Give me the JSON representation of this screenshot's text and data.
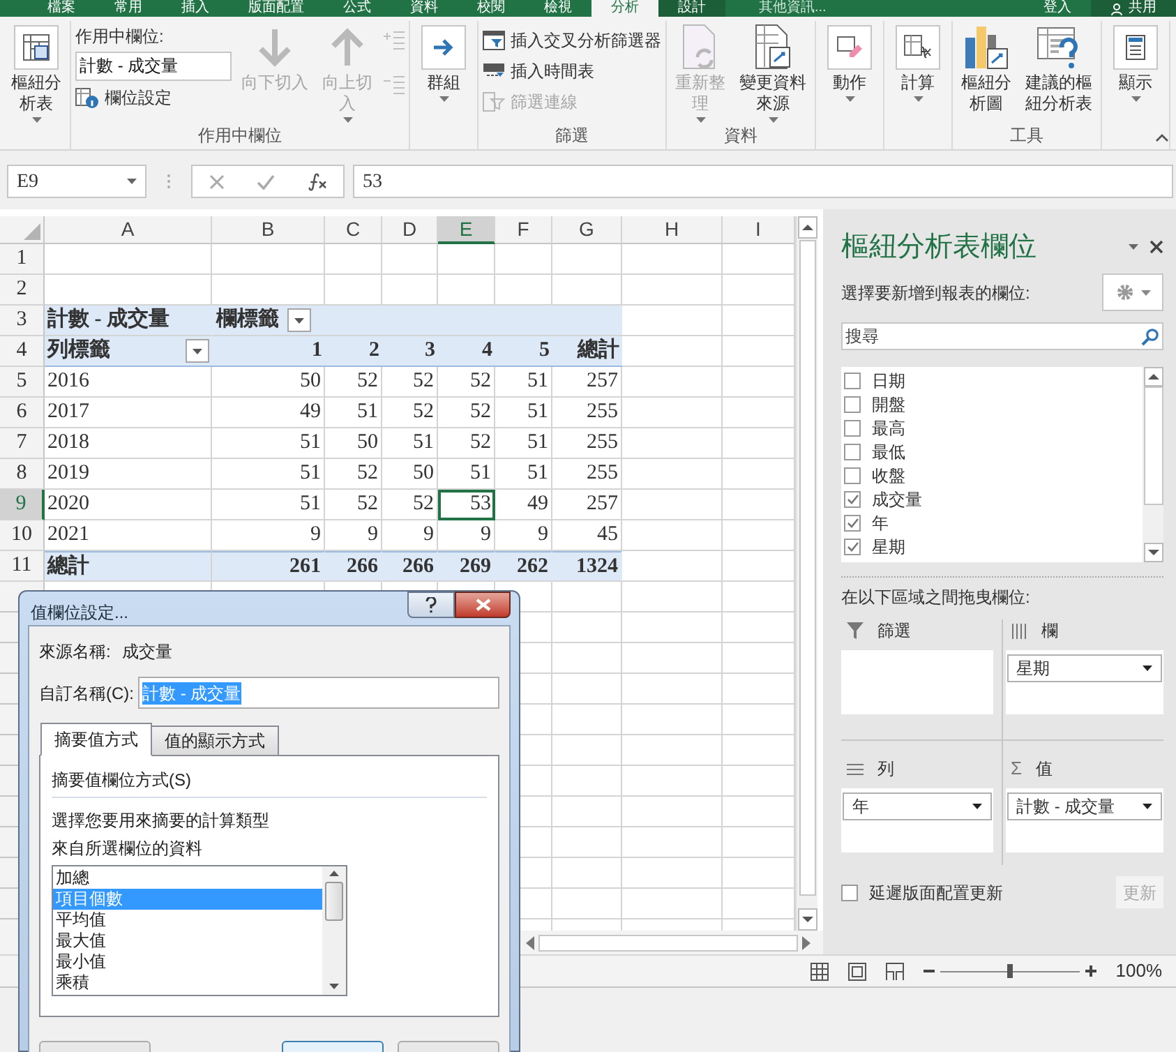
{
  "menu_tabs": [
    {
      "label": "檔案",
      "selected": false
    },
    {
      "label": "常用",
      "selected": false
    },
    {
      "label": "插入",
      "selected": false
    },
    {
      "label": "版面配置",
      "selected": false
    },
    {
      "label": "公式",
      "selected": false
    },
    {
      "label": "資料",
      "selected": false
    },
    {
      "label": "校閱",
      "selected": false
    },
    {
      "label": "檢視",
      "selected": false
    },
    {
      "label": "分析",
      "selected": true
    },
    {
      "label": "設計",
      "selected": false
    }
  ],
  "tell_me": "其他資訊...",
  "sign_in": "登入",
  "share": "共用",
  "ribbon": [
    {
      "kind": "buttons",
      "buttons": [
        {
          "label": "樞紐分析表",
          "dropdown": true,
          "disabled": false
        }
      ]
    },
    {
      "kind": "active-field",
      "label": "作用中欄位",
      "caption": "作用中欄位:",
      "value": "計數 - 成交量",
      "settings": "欄位設定",
      "buttons": [
        {
          "label": "向下切入",
          "dropdown": false,
          "disabled": true
        },
        {
          "label": "向上切入",
          "dropdown": true,
          "disabled": true
        }
      ]
    },
    {
      "kind": "buttons",
      "buttons": [
        {
          "label": "群組",
          "dropdown": true,
          "disabled": false
        }
      ]
    },
    {
      "kind": "list",
      "label": "篩選",
      "items": [
        {
          "label": "插入交叉分析篩選器",
          "disabled": false
        },
        {
          "label": "插入時間表",
          "disabled": false
        },
        {
          "label": "篩選連線",
          "disabled": true
        }
      ]
    },
    {
      "kind": "buttons",
      "label": "資料",
      "buttons": [
        {
          "label": "重新整理",
          "dropdown": true,
          "disabled": true
        },
        {
          "label": "變更資料來源",
          "dropdown": true,
          "disabled": false
        }
      ]
    },
    {
      "kind": "buttons",
      "buttons": [
        {
          "label": "動作",
          "dropdown": true,
          "disabled": false
        }
      ]
    },
    {
      "kind": "buttons",
      "buttons": [
        {
          "label": "計算",
          "dropdown": true,
          "disabled": false
        }
      ]
    },
    {
      "kind": "buttons",
      "label": "工具",
      "buttons": [
        {
          "label": "樞紐分析圖",
          "dropdown": false,
          "disabled": false
        },
        {
          "label": "建議的樞紐分析表",
          "dropdown": false,
          "disabled": false
        }
      ]
    },
    {
      "kind": "buttons",
      "buttons": [
        {
          "label": "顯示",
          "dropdown": true,
          "disabled": false
        }
      ]
    }
  ],
  "name_box": "E9",
  "formula": "53",
  "columns": [
    {
      "label": "A",
      "selected": false
    },
    {
      "label": "B",
      "selected": false
    },
    {
      "label": "C",
      "selected": false
    },
    {
      "label": "D",
      "selected": false
    },
    {
      "label": "E",
      "selected": true
    },
    {
      "label": "F",
      "selected": false
    },
    {
      "label": "G",
      "selected": false
    },
    {
      "label": "H",
      "selected": false
    },
    {
      "label": "I",
      "selected": false
    }
  ],
  "rows": [
    {
      "number": "1",
      "selected": false,
      "kind": "empty"
    },
    {
      "number": "2",
      "selected": false,
      "kind": "empty"
    },
    {
      "number": "3",
      "selected": false,
      "kind": "pivot-title",
      "value_label": "計數 - 成交量",
      "column_label": "欄標籤"
    },
    {
      "number": "4",
      "selected": false,
      "kind": "pivot-header",
      "row_label": "列標籤",
      "cells": [
        "1",
        "2",
        "3",
        "4",
        "5",
        "總計"
      ]
    },
    {
      "number": "5",
      "selected": false,
      "kind": "data",
      "label": "2016",
      "cells": [
        {
          "text": "50",
          "selected": false
        },
        {
          "text": "52",
          "selected": false
        },
        {
          "text": "52",
          "selected": false
        },
        {
          "text": "52",
          "selected": false
        },
        {
          "text": "51",
          "selected": false
        },
        {
          "text": "257",
          "selected": false
        }
      ]
    },
    {
      "number": "6",
      "selected": false,
      "kind": "data",
      "label": "2017",
      "cells": [
        {
          "text": "49",
          "selected": false
        },
        {
          "text": "51",
          "selected": false
        },
        {
          "text": "52",
          "selected": false
        },
        {
          "text": "52",
          "selected": false
        },
        {
          "text": "51",
          "selected": false
        },
        {
          "text": "255",
          "selected": false
        }
      ]
    },
    {
      "number": "7",
      "selected": false,
      "kind": "data",
      "label": "2018",
      "cells": [
        {
          "text": "51",
          "selected": false
        },
        {
          "text": "50",
          "selected": false
        },
        {
          "text": "51",
          "selected": false
        },
        {
          "text": "52",
          "selected": false
        },
        {
          "text": "51",
          "selected": false
        },
        {
          "text": "255",
          "selected": false
        }
      ]
    },
    {
      "number": "8",
      "selected": false,
      "kind": "data",
      "label": "2019",
      "cells": [
        {
          "text": "51",
          "selected": false
        },
        {
          "text": "52",
          "selected": false
        },
        {
          "text": "50",
          "selected": false
        },
        {
          "text": "51",
          "selected": false
        },
        {
          "text": "51",
          "selected": false
        },
        {
          "text": "255",
          "selected": false
        }
      ]
    },
    {
      "number": "9",
      "selected": true,
      "kind": "data",
      "label": "2020",
      "cells": [
        {
          "text": "51",
          "selected": false
        },
        {
          "text": "52",
          "selected": false
        },
        {
          "text": "52",
          "selected": false
        },
        {
          "text": "53",
          "selected": true
        },
        {
          "text": "49",
          "selected": false
        },
        {
          "text": "257",
          "selected": false
        }
      ]
    },
    {
      "number": "10",
      "selected": false,
      "kind": "data",
      "label": "2021",
      "cells": [
        {
          "text": "9",
          "selected": false
        },
        {
          "text": "9",
          "selected": false
        },
        {
          "text": "9",
          "selected": false
        },
        {
          "text": "9",
          "selected": false
        },
        {
          "text": "9",
          "selected": false
        },
        {
          "text": "45",
          "selected": false
        }
      ]
    },
    {
      "number": "11",
      "selected": false,
      "kind": "total",
      "label": "總計",
      "cells": [
        "261",
        "266",
        "266",
        "269",
        "262",
        "1324"
      ]
    }
  ],
  "pivot_panel": {
    "title": "樞紐分析表欄位",
    "prompt": "選擇要新增到報表的欄位:",
    "search_placeholder": "搜尋",
    "fields": [
      {
        "label": "日期",
        "checked": false
      },
      {
        "label": "開盤",
        "checked": false
      },
      {
        "label": "最高",
        "checked": false
      },
      {
        "label": "最低",
        "checked": false
      },
      {
        "label": "收盤",
        "checked": false
      },
      {
        "label": "成交量",
        "checked": true
      },
      {
        "label": "年",
        "checked": true
      },
      {
        "label": "星期",
        "checked": true
      }
    ],
    "areas_prompt": "在以下區域之間拖曳欄位:",
    "areas": [
      {
        "kind": "filters",
        "label": "篩選"
      },
      {
        "kind": "columns",
        "label": "欄",
        "items": [
          "星期"
        ]
      },
      {
        "kind": "rows",
        "label": "列",
        "items": [
          "年"
        ]
      },
      {
        "kind": "values",
        "label": "值",
        "symbol": "Σ",
        "items": [
          "計數 - 成交量"
        ]
      }
    ],
    "defer": {
      "label": "延遲版面配置更新",
      "checked": false
    },
    "update": {
      "label": "更新",
      "disabled": true
    }
  },
  "status_bar": {
    "zoom": "100%",
    "level": 0.5
  },
  "dialog": {
    "title": "值欄位設定...",
    "source_caption": "來源名稱:",
    "source": "成交量",
    "name_caption": "自訂名稱(C):",
    "name_value": "計數 - 成交量",
    "tabs": [
      {
        "label": "摘要值方式",
        "selected": true
      },
      {
        "label": "值的顯示方式",
        "selected": false
      }
    ],
    "section": "摘要值欄位方式(S)",
    "description": [
      "選擇您要用來摘要的計算類型",
      "來自所選欄位的資料"
    ],
    "options": [
      {
        "label": "加總",
        "selected": false
      },
      {
        "label": "項目個數",
        "selected": true
      },
      {
        "label": "平均值",
        "selected": false
      },
      {
        "label": "最大值",
        "selected": false
      },
      {
        "label": "最小值",
        "selected": false
      },
      {
        "label": "乘積",
        "selected": false
      }
    ]
  }
}
